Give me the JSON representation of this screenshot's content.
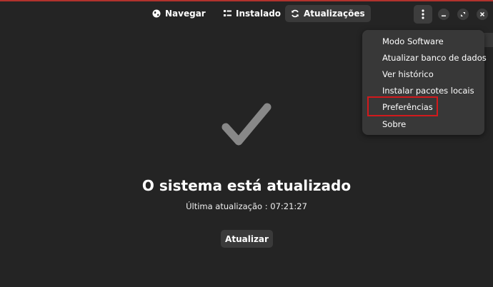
{
  "header": {
    "tabs": [
      {
        "label": "Navegar",
        "icon": "globe-icon",
        "active": false
      },
      {
        "label": "Instalado",
        "icon": "list-icon",
        "active": false
      },
      {
        "label": "Atualizações",
        "icon": "refresh-icon",
        "active": true
      }
    ]
  },
  "main": {
    "title": "O sistema está atualizado",
    "subtitle": "Última atualização : 07:21:27",
    "update_button": "Atualizar"
  },
  "menu": {
    "items": [
      {
        "label": "Modo Software"
      },
      {
        "label": "Atualizar banco de dados"
      },
      {
        "label": "Ver histórico"
      },
      {
        "label": "Instalar pacotes locais"
      },
      {
        "label": "Preferências",
        "highlighted": true
      },
      {
        "label": "Sobre"
      }
    ]
  },
  "colors": {
    "background": "#242424",
    "button": "#3a3a3a",
    "popover": "#383838",
    "checkmark": "#888888",
    "highlight_border": "#d2191c",
    "top_border": "#b1322d"
  }
}
